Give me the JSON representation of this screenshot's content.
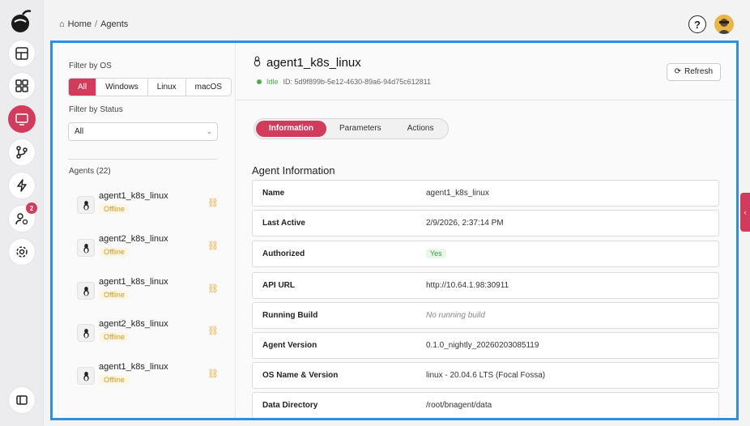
{
  "breadcrumb": {
    "home": "Home",
    "separator": "/",
    "current": "Agents"
  },
  "rail": {
    "items": [
      "dashboard-icon",
      "grid-icon",
      "monitor-icon",
      "branch-icon",
      "lightning-icon",
      "user-settings-icon",
      "gear-icon"
    ],
    "active": "monitor-icon",
    "user_badge": "2",
    "bottom": "sidebar-toggle-icon"
  },
  "filters": {
    "os_label": "Filter by OS",
    "os_options": [
      "All",
      "Windows",
      "Linux",
      "macOS"
    ],
    "os_selected": "All",
    "status_label": "Filter by Status",
    "status_value": "All"
  },
  "agents": {
    "header": "Agents (22)",
    "items": [
      {
        "name": "agent1_k8s_linux",
        "status": "Offline"
      },
      {
        "name": "agent2_k8s_linux",
        "status": "Offline"
      },
      {
        "name": "agent1_k8s_linux",
        "status": "Offline"
      },
      {
        "name": "agent2_k8s_linux",
        "status": "Offline"
      },
      {
        "name": "agent1_k8s_linux",
        "status": "Offline"
      }
    ]
  },
  "detail": {
    "title": "agent1_k8s_linux",
    "status": "Idle",
    "id": "ID: 5d9f899b-5e12-4630-89a6-94d75c612811",
    "refresh_label": "Refresh",
    "tabs": [
      "Information",
      "Parameters",
      "Actions"
    ],
    "active_tab": "Information",
    "section_title": "Agent Information",
    "rows": [
      {
        "key": "Name",
        "value": "agent1_k8s_linux"
      },
      {
        "key": "Last Active",
        "value": "2/9/2026, 2:37:14 PM"
      },
      {
        "key": "Authorized",
        "value": "Yes"
      },
      {
        "key": "API URL",
        "value": "http://10.64.1.98:30911"
      },
      {
        "key": "Running Build",
        "value": "No running build"
      },
      {
        "key": "Agent Version",
        "value": "0.1.0_nightly_20260203085119"
      },
      {
        "key": "OS Name & Version",
        "value": "linux - 20.04.6 LTS (Focal Fossa)"
      },
      {
        "key": "Data Directory",
        "value": "/root/bnagent/data"
      }
    ]
  },
  "colors": {
    "accent": "#d13b5c",
    "focus_border": "#2f8fde",
    "idle": "#4caf50",
    "offline": "#c99a2a"
  }
}
